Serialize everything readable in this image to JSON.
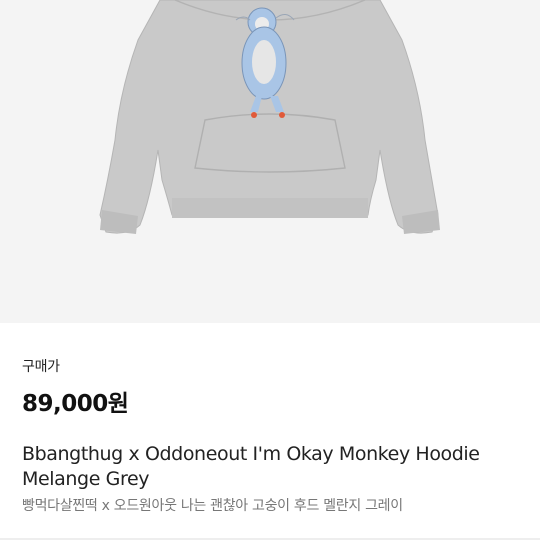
{
  "product": {
    "image_icon": "hoodie-photo",
    "price_label": "구매가",
    "price": "89,000원",
    "name_en": "Bbangthug x Oddoneout I'm Okay Monkey Hoodie Melange Grey",
    "name_ko": "빵먹다살찐떡 x 오드원아웃 나는 괜찮아 고숭이 후드 멜란지 그레이"
  },
  "colors": {
    "background": "#f4f4f4",
    "hoodie": "#c9c9c9",
    "print_blue": "#a9c5e6"
  }
}
